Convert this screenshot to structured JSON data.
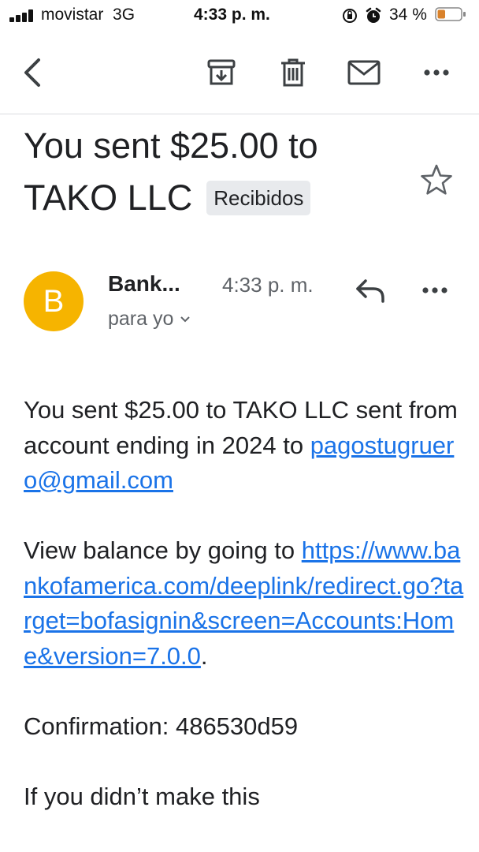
{
  "status_bar": {
    "carrier": "movistar",
    "network": "3G",
    "time": "4:33 p. m.",
    "battery": "34 %",
    "battery_level": 0.34
  },
  "toolbar": {
    "back_icon": "back-arrow-icon",
    "archive_icon": "archive-icon",
    "delete_icon": "trash-icon",
    "unread_icon": "mail-icon",
    "more_icon": "more-horizontal-icon"
  },
  "subject": {
    "line1": "You sent $25.00 to",
    "line2": "TAKO LLC",
    "label": "Recibidos"
  },
  "message": {
    "avatar_letter": "B",
    "avatar_color": "#f6b400",
    "sender": "Bank...",
    "time": "4:33 p. m.",
    "recipient": "para yo"
  },
  "body": {
    "p1_text": "You sent $25.00 to TAKO LLC sent from account ending in 2024 to ",
    "p1_link": "pagostugruero@gmail.com",
    "p2_text": "View balance by going to ",
    "p2_link": "https://www.bankofamerica.com/deeplink/redirect.go?target=bofasignin&screen=Accounts:Home&version=7.0.0",
    "p2_end": ".",
    "p3": "Confirmation: 486530d59",
    "p4": "If you didn’t make this"
  },
  "colors": {
    "link": "#1a73e8",
    "divider": "#dadce0",
    "label_bg": "#e8eaed",
    "battery_fill": "#d9822b"
  }
}
